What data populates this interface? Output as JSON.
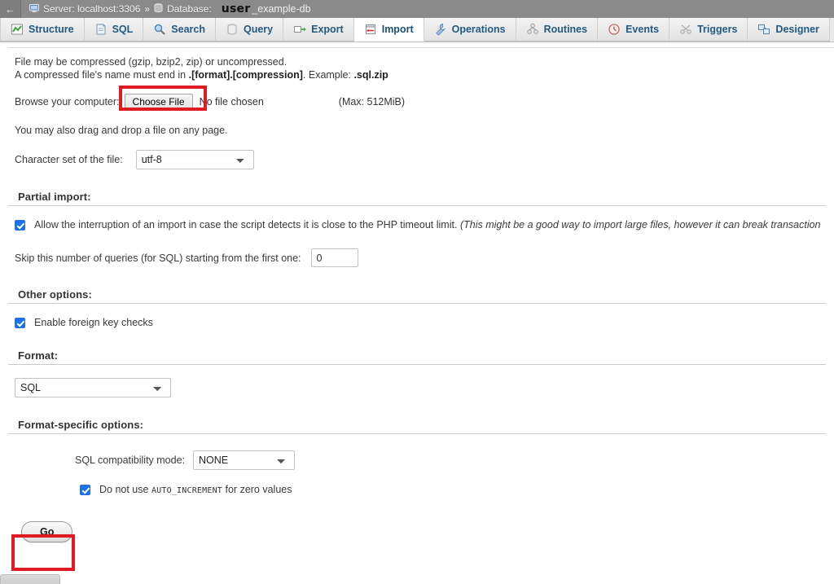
{
  "breadcrumb": {
    "back_arrow": "←",
    "server_icon": "server-icon",
    "server_label": "Server: localhost:3306",
    "separator": "»",
    "database_icon": "database-icon",
    "database_label": "Database:",
    "db_name_highlight": "user",
    "db_name_rest": "_example-db"
  },
  "tabs": [
    {
      "label": "Structure",
      "icon": "structure-icon",
      "active": false
    },
    {
      "label": "SQL",
      "icon": "sql-icon",
      "active": false
    },
    {
      "label": "Search",
      "icon": "search-icon",
      "active": false
    },
    {
      "label": "Query",
      "icon": "query-icon",
      "active": false
    },
    {
      "label": "Export",
      "icon": "export-icon",
      "active": false
    },
    {
      "label": "Import",
      "icon": "import-icon",
      "active": true
    },
    {
      "label": "Operations",
      "icon": "wrench-icon",
      "active": false
    },
    {
      "label": "Routines",
      "icon": "routines-icon",
      "active": false
    },
    {
      "label": "Events",
      "icon": "clock-icon",
      "active": false
    },
    {
      "label": "Triggers",
      "icon": "triggers-icon",
      "active": false
    },
    {
      "label": "Designer",
      "icon": "designer-icon",
      "active": false
    }
  ],
  "file_to_import": {
    "compression_line_1": "File may be compressed (gzip, bzip2, zip) or uncompressed.",
    "compression_line_2_prefix": "A compressed file's name must end in ",
    "compression_line_2_bold": ".[format].[compression]",
    "compression_line_2_mid": ". Example: ",
    "compression_line_2_example": ".sql.zip",
    "browse_label": "Browse your computer:",
    "choose_file_button": "Choose File",
    "no_file_chosen": "No file chosen",
    "max_size": "(Max: 512MiB)",
    "dragdrop_hint": "You may also drag and drop a file on any page.",
    "charset_label": "Character set of the file:",
    "charset_value": "utf-8"
  },
  "partial_import": {
    "heading": "Partial import:",
    "allow_interruption_label": "Allow the interruption of an import in case the script detects it is close to the PHP timeout limit.",
    "allow_interruption_note": "(This might be a good way to import large files, however it can break transaction",
    "allow_interruption_checked": true,
    "skip_label": "Skip this number of queries (for SQL) starting from the first one:",
    "skip_value": "0"
  },
  "other_options": {
    "heading": "Other options:",
    "foreign_key_label": "Enable foreign key checks",
    "foreign_key_checked": true
  },
  "format": {
    "heading": "Format:",
    "value": "SQL"
  },
  "format_specific": {
    "heading": "Format-specific options:",
    "compat_label": "SQL compatibility mode:",
    "compat_value": "NONE",
    "auto_increment_prefix": "Do not use ",
    "auto_increment_keyword": "AUTO_INCREMENT",
    "auto_increment_suffix": " for zero values",
    "auto_increment_checked": true
  },
  "submit": {
    "go_label": "Go"
  },
  "colors": {
    "annotation_red": "#e01b22",
    "checkbox_blue": "#1a73e8",
    "tab_link": "#235a81",
    "header_gray": "#8a8a8a"
  }
}
